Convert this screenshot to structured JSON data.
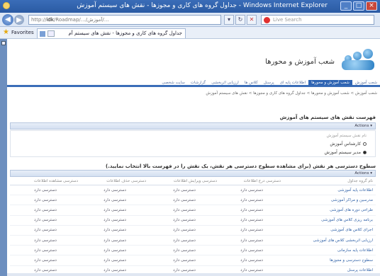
{
  "window": {
    "title": "جداول گروه های کاری و مجوزها - نقش های سیستم آموزش - Windows Internet Explorer",
    "controls": [
      "_",
      "□",
      "×"
    ]
  },
  "browser": {
    "url_prefix": "http://",
    "url_host": "idk",
    "url_path": "/Roadmap/…/آموزش/…",
    "search_placeholder": "Live Search",
    "favorites_label": "Favorites",
    "tab_title": "جداول گروه های کاری و مجوزها - نقش های سیستم آم"
  },
  "site": {
    "title": "شعب آموزش و محورها",
    "nav": [
      {
        "label": "شعب آموزش"
      },
      {
        "label": "شعب آموزش و محورها",
        "active": true
      },
      {
        "label": "اطلاعات پایه ای"
      },
      {
        "label": "پرسنل"
      },
      {
        "label": "کلاس ها"
      },
      {
        "label": "ارزیابی اثربخشی"
      },
      {
        "label": "گزارشات"
      },
      {
        "label": "سایت شخصی"
      }
    ],
    "breadcrumb": "شعب آموزش > شعب آموزش و محورها > جداول گروه های کاری و مجوزها > نقش های سیستم آموزش"
  },
  "roles_list": {
    "title": "فهرست نقش های سیستم های آموزش",
    "actions_label": "Actions",
    "field_label": "نام نقش سیستم آموزش",
    "options": [
      {
        "label": "کارشناس آموزش",
        "selected": false
      },
      {
        "label": "مدیر سیستم آموزش",
        "selected": true
      }
    ]
  },
  "access_levels": {
    "title": "سطوح دسترسی هر نقش (برای مشاهده سطوح دسترسی هر نقش، یک نقش را در فهرست بالا انتخاب نمایید.)",
    "actions_label": "Actions",
    "columns": [
      "نام گروه جداول",
      "دسترسی درج اطلاعات",
      "دسترسی ویرایش اطلاعات",
      "دسترسی حذف اطلاعات",
      "دسترسی مشاهده اطلاعات"
    ],
    "rows": [
      {
        "group": "اطلاعات پایه آموزشی",
        "insert": "دسترسی دارد",
        "edit": "دسترسی دارد",
        "delete": "دسترسی دارد",
        "view": "دسترسی دارد"
      },
      {
        "group": "مدرسین و مراکز آموزشی",
        "insert": "دسترسی دارد",
        "edit": "دسترسی دارد",
        "delete": "دسترسی دارد",
        "view": "دسترسی دارد"
      },
      {
        "group": "طراحی دوره های آموزشی",
        "insert": "دسترسی دارد",
        "edit": "دسترسی دارد",
        "delete": "دسترسی دارد",
        "view": "دسترسی دارد"
      },
      {
        "group": "برنامه ریزی کلاس های آموزشی",
        "insert": "دسترسی دارد",
        "edit": "دسترسی دارد",
        "delete": "دسترسی دارد",
        "view": "دسترسی دارد"
      },
      {
        "group": "اجرای کلاس های آموزشی",
        "insert": "دسترسی دارد",
        "edit": "دسترسی دارد",
        "delete": "دسترسی دارد",
        "view": "دسترسی دارد"
      },
      {
        "group": "ارزیابی اثربخشی کلاس های آموزشی",
        "insert": "دسترسی دارد",
        "edit": "دسترسی دارد",
        "delete": "دسترسی دارد",
        "view": "دسترسی دارد"
      },
      {
        "group": "اطلاعات پایه سازمانی",
        "insert": "دسترسی دارد",
        "edit": "دسترسی دارد",
        "delete": "دسترسی دارد",
        "view": "دسترسی دارد"
      },
      {
        "group": "سطوح دسترسی و مجوزها",
        "insert": "دسترسی دارد",
        "edit": "دسترسی دارد",
        "delete": "دسترسی دارد",
        "view": "دسترسی دارد"
      },
      {
        "group": "اطلاعات پرسنل",
        "insert": "دسترسی دارد",
        "edit": "دسترسی دارد",
        "delete": "دسترسی دارد",
        "view": "دسترسی دارد"
      }
    ]
  },
  "colors": {
    "accent": "#2e64b3",
    "link": "#2d5fa6",
    "window_frame": "#6d8fbf"
  }
}
